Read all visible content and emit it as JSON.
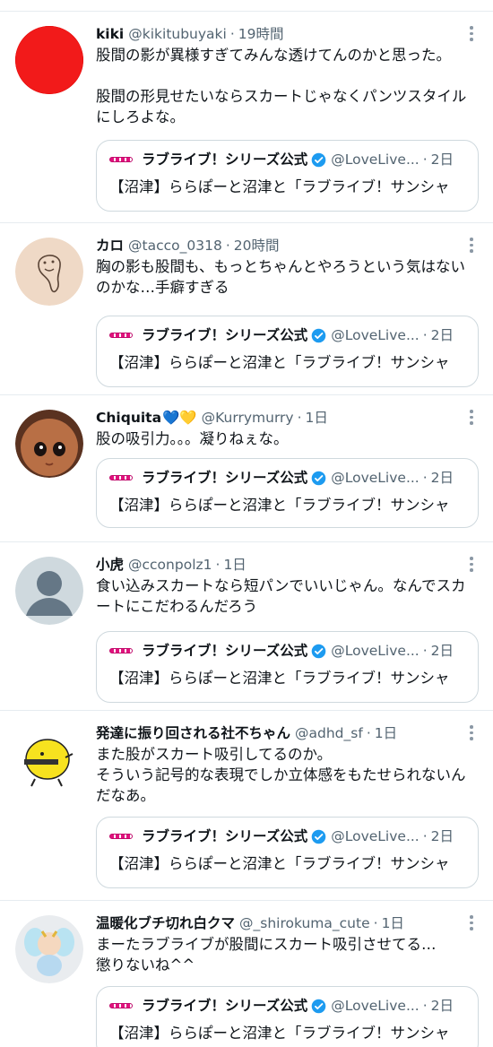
{
  "tweets": [
    {
      "name": "kiki",
      "name_emoji": "",
      "handle": "@kikitubuyaki",
      "time": "19時間",
      "text": "股間の影が異様すぎてみんな透けてんのかと思った。\n\n股間の形見せたいならスカートじゃなくパンツスタイルにしろよな。",
      "avatar": "red-circle"
    },
    {
      "name": "カロ",
      "name_emoji": "",
      "handle": "@tacco_0318",
      "time": "20時間",
      "text": "胸の影も股間も、もっとちゃんとやろうという気はないのかな…手癖すぎる",
      "avatar": "sketch-figure"
    },
    {
      "name": "Chiquita",
      "name_emoji": "💙💛",
      "handle": "@Kurrymurry",
      "time": "1日",
      "text": "股の吸引力。。。凝りねぇな。",
      "avatar": "doll-face"
    },
    {
      "name": "小虎",
      "name_emoji": "",
      "handle": "@cconpolz1",
      "time": "1日",
      "text": "食い込みスカートなら短パンでいいじゃん。なんでスカートにこだわるんだろう",
      "avatar": "default-user"
    },
    {
      "name": "発達に振り回される社不ちゃん",
      "name_emoji": "",
      "handle": "@adhd_sf",
      "time": "1日",
      "text": "また股がスカート吸引してるのか。\nそういう記号的な表現でしか立体感をもたせられないんだなあ。",
      "avatar": "yellow-chick"
    },
    {
      "name": "温暖化ブチ切れ白クマ",
      "name_emoji": "",
      "handle": "@_shirokuma_cute",
      "time": "1日",
      "text": "まーたラブライブが股間にスカート吸引させてる…\n懲りないね^^",
      "avatar": "fairy-baby"
    }
  ],
  "quote": {
    "name": "ラブライブ！シリーズ公式",
    "handle": "@LoveLive...",
    "time": "2日",
    "text": "【沼津】ららぽーと沼津と「ラブライブ！サンシャ"
  },
  "dot": "·",
  "colors": {
    "muted": "#536471",
    "verified": "#1d9bf0",
    "border": "#cfd9de"
  }
}
